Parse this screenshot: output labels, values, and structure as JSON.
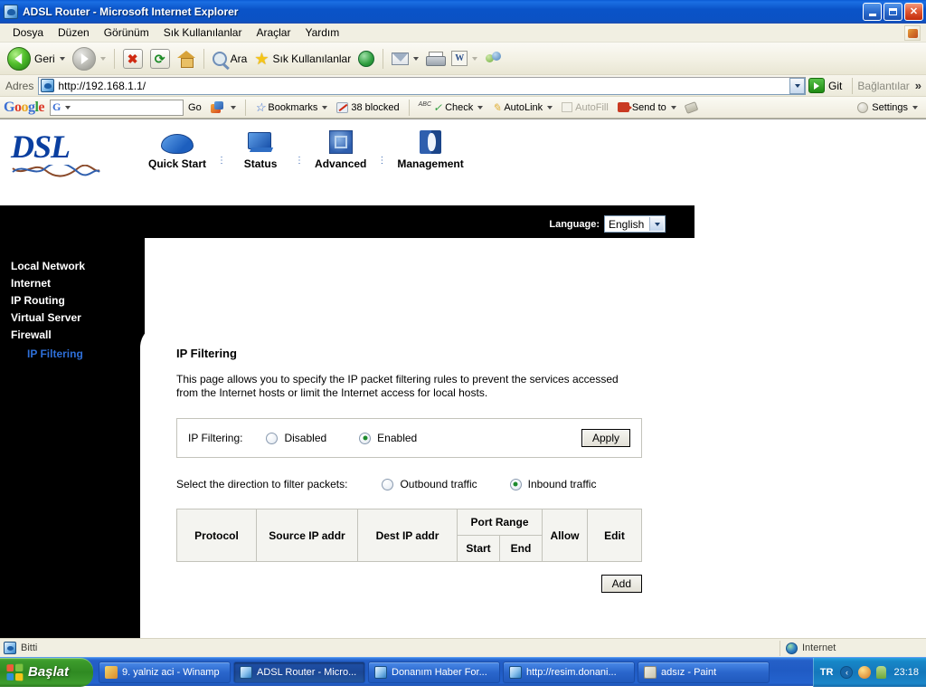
{
  "window": {
    "title": "ADSL Router - Microsoft Internet Explorer",
    "icon": "ie-document-icon",
    "minimize": "minimize-button",
    "maximize": "restore-button",
    "close": "close-button"
  },
  "menu": {
    "items": [
      "Dosya",
      "Düzen",
      "Görünüm",
      "Sık Kullanılanlar",
      "Araçlar",
      "Yardım"
    ]
  },
  "toolbar": {
    "back": "Geri",
    "search": "Ara",
    "favorites": "Sık Kullanılanlar"
  },
  "address": {
    "label": "Adres",
    "url": "http://192.168.1.1/",
    "go": "Git",
    "links": "Bağlantılar",
    "more": "»"
  },
  "google_toolbar": {
    "logo": "Google",
    "search_value": "",
    "go": "Go",
    "bookmarks": "Bookmarks",
    "blocked": "38 blocked",
    "check": "Check",
    "autolink": "AutoLink",
    "autofill": "AutoFill",
    "sendto": "Send to",
    "settings": "Settings"
  },
  "router": {
    "logo": "DSL",
    "nav": [
      {
        "label": "Quick Start",
        "icon": "mouse-icon"
      },
      {
        "label": "Status",
        "icon": "monitor-icon"
      },
      {
        "label": "Advanced",
        "icon": "chip-icon"
      },
      {
        "label": "Management",
        "icon": "book-icon"
      }
    ],
    "nav_separator": ":",
    "language_label": "Language:",
    "language_value": "English",
    "sidebar": [
      {
        "label": "Local Network",
        "sub": false
      },
      {
        "label": "Internet",
        "sub": false
      },
      {
        "label": "IP Routing",
        "sub": false
      },
      {
        "label": "Virtual Server",
        "sub": false
      },
      {
        "label": "Firewall",
        "sub": false
      },
      {
        "label": "IP Filtering",
        "sub": true
      }
    ],
    "page": {
      "title": "IP Filtering",
      "description": "This page allows you to specify the IP packet filtering rules to prevent the services accessed from the Internet hosts or limit the Internet access for local hosts.",
      "filter_label": "IP Filtering:",
      "filter_options": [
        {
          "label": "Disabled",
          "selected": false
        },
        {
          "label": "Enabled",
          "selected": true
        }
      ],
      "apply_label": "Apply",
      "direction_label": "Select the direction to filter packets:",
      "direction_options": [
        {
          "label": "Outbound traffic",
          "selected": false
        },
        {
          "label": "Inbound traffic",
          "selected": true
        }
      ],
      "table": {
        "headers": [
          "Protocol",
          "Source IP addr",
          "Dest IP addr",
          "Port Range",
          "Allow",
          "Edit"
        ],
        "port_range_sub": [
          "Start",
          "End"
        ],
        "rows": []
      },
      "add_label": "Add"
    }
  },
  "statusbar": {
    "text": "Bitti",
    "zone": "Internet"
  },
  "taskbar": {
    "start": "Başlat",
    "tasks": [
      {
        "label": "9. yalniz aci - Winamp",
        "icon": "winamp-icon",
        "active": false
      },
      {
        "label": "ADSL Router - Micro...",
        "icon": "ie-icon",
        "active": true
      },
      {
        "label": "Donanım Haber For...",
        "icon": "ie-icon",
        "active": false
      },
      {
        "label": "http://resim.donani...",
        "icon": "ie-icon",
        "active": false
      },
      {
        "label": "adsız - Paint",
        "icon": "paint-icon",
        "active": false
      }
    ],
    "tray_lang": "TR",
    "clock": "23:18"
  },
  "colors": {
    "titlebar": "#0a53c8",
    "sidebar": "#000000",
    "link": "#2e6fd8",
    "logo": "#0a3fa0",
    "radio_on": "#1d8a2c"
  }
}
